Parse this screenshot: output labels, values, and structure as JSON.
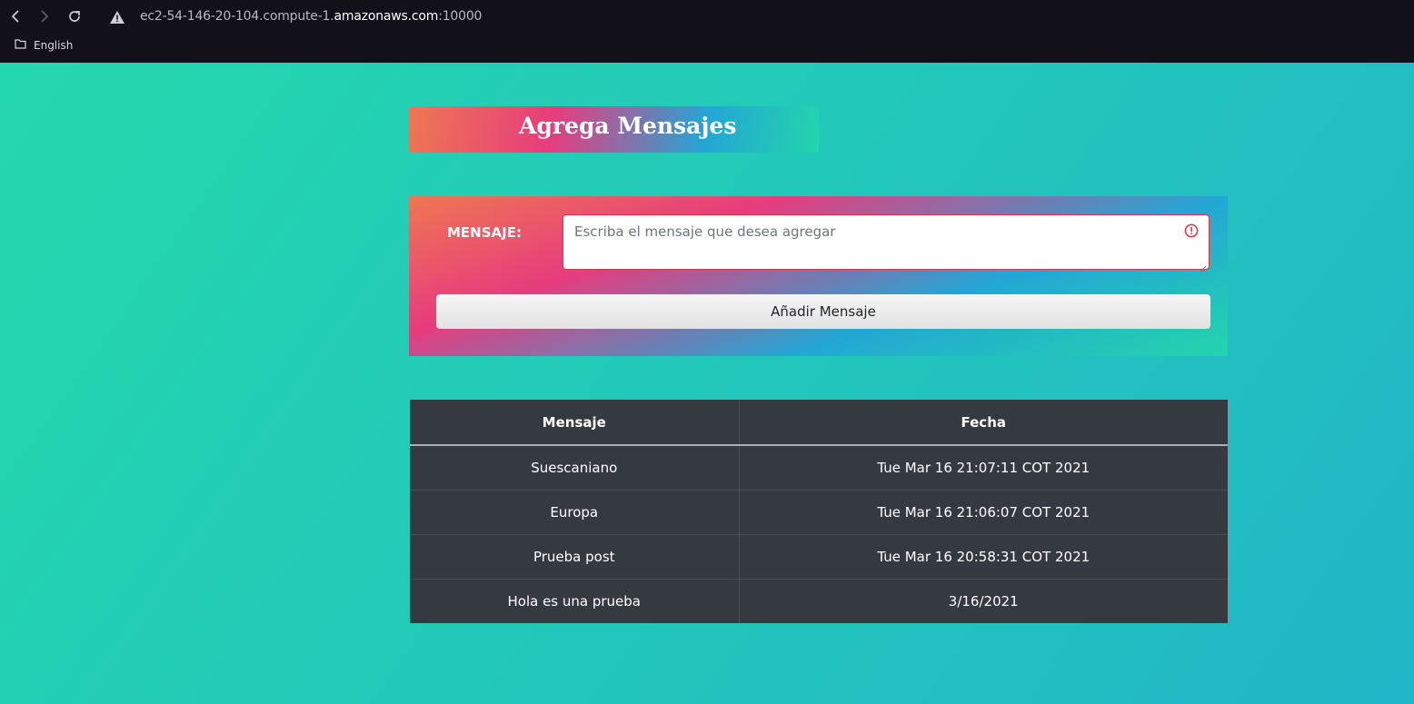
{
  "browser": {
    "url_prefix": "ec2-54-146-20-104.compute-1.",
    "url_host": "amazonaws.com",
    "url_suffix": ":10000",
    "bookmark_label": "English"
  },
  "header": {
    "title": "Agrega Mensajes"
  },
  "form": {
    "label": "MENSAJE:",
    "placeholder": "Escriba el mensaje que desea agregar",
    "value": "",
    "submit_label": "Añadir Mensaje",
    "error_color": "#dc3545"
  },
  "table": {
    "columns": [
      "Mensaje",
      "Fecha"
    ],
    "rows": [
      [
        "Suescaniano",
        "Tue Mar 16 21:07:11 COT 2021"
      ],
      [
        "Europa",
        "Tue Mar 16 21:06:07 COT 2021"
      ],
      [
        "Prueba post",
        "Tue Mar 16 20:58:31 COT 2021"
      ],
      [
        "Hola es una prueba",
        "3/16/2021"
      ]
    ]
  },
  "colors": {
    "page_bg": "#24d6ad",
    "gradient": [
      "#ee7752",
      "#e73c7e",
      "#23a6d5",
      "#23d5ab"
    ],
    "table_bg": "#343a40"
  },
  "icons": [
    "back-arrow-icon",
    "forward-arrow-icon",
    "reload-icon",
    "warning-icon",
    "folder-icon",
    "alert-circle-icon"
  ]
}
